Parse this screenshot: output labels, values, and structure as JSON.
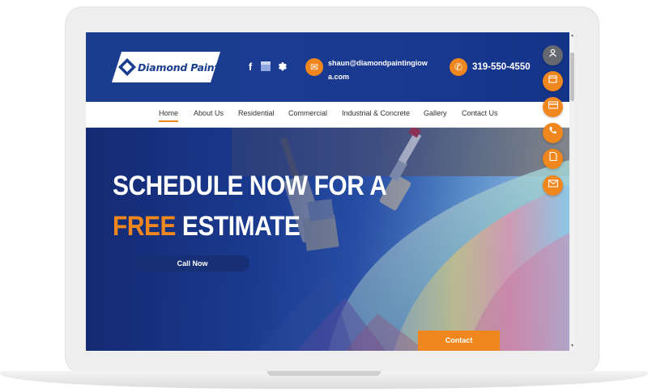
{
  "header": {
    "logo_text": "Diamond Painting",
    "email": "shaun@diamondpaintingiowa.com",
    "phone": "319-550-4550"
  },
  "social": [
    {
      "icon": "facebook-icon",
      "glyph": "f"
    },
    {
      "icon": "google-business-icon",
      "glyph": "▦"
    },
    {
      "icon": "yelp-icon",
      "glyph": "✽"
    }
  ],
  "nav": {
    "items": [
      "Home",
      "About Us",
      "Residential",
      "Commercial",
      "Industrial & Concrete",
      "Gallery",
      "Contact Us"
    ],
    "active": "Home"
  },
  "hero": {
    "line1": "SCHEDULE NOW FOR A",
    "line2_highlight": "FREE",
    "line2_rest": "ESTIMATE",
    "cta_label": "Call Now"
  },
  "contact_tab": "Contact",
  "side_buttons": [
    {
      "icon": "user-icon",
      "glyph": "👤"
    },
    {
      "icon": "calendar-icon",
      "glyph": "▦"
    },
    {
      "icon": "credit-card-icon",
      "glyph": "▭"
    },
    {
      "icon": "phone-icon",
      "glyph": "✆"
    },
    {
      "icon": "document-icon",
      "glyph": "▯"
    },
    {
      "icon": "mail-icon",
      "glyph": "✉"
    }
  ],
  "colors": {
    "brand_blue": "#1a3d8f",
    "accent_orange": "#f0871e",
    "button_navy": "#172f74"
  }
}
